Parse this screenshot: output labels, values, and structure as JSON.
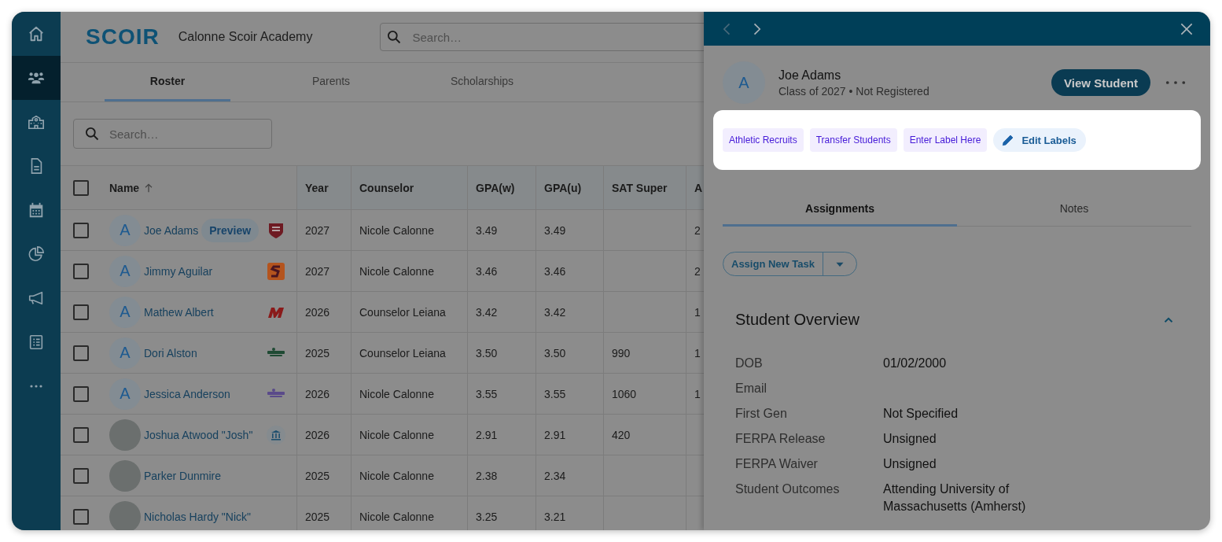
{
  "sidebar": {
    "items": [
      {
        "kind": "home",
        "selected": false
      },
      {
        "kind": "people",
        "selected": true
      },
      {
        "kind": "school",
        "selected": false
      },
      {
        "kind": "document",
        "selected": false
      },
      {
        "kind": "calendar",
        "selected": false
      },
      {
        "kind": "chart",
        "selected": false
      },
      {
        "kind": "megaphone",
        "selected": false
      },
      {
        "kind": "checklist",
        "selected": false
      },
      {
        "kind": "more",
        "selected": false
      }
    ]
  },
  "header": {
    "logo": "SCOIR",
    "school": "Calonne Scoir Academy",
    "search": {
      "placeholder": "Search…"
    }
  },
  "tabs": [
    {
      "label": "Roster",
      "selected": true
    },
    {
      "label": "Parents",
      "selected": false
    },
    {
      "label": "Scholarships",
      "selected": false
    }
  ],
  "roster_search": {
    "placeholder": "Search…"
  },
  "table": {
    "select_all_checked": false,
    "columns": [
      {
        "label": "Name",
        "sorted": true
      },
      {
        "label": "Year"
      },
      {
        "label": "Counselor"
      },
      {
        "label": "GPA(w)"
      },
      {
        "label": "GPA(u)"
      },
      {
        "label": "SAT Super"
      },
      {
        "label": "A"
      }
    ],
    "rows": [
      {
        "checked": false,
        "avatar": {
          "kind": "initial",
          "text": "A"
        },
        "preview": "Preview",
        "logo": {
          "kind": "shield",
          "color": "#6e1a22"
        },
        "cells": [
          "Joe Adams",
          "2027",
          "Nicole Calonne",
          "3.49",
          "3.49",
          "",
          "2"
        ]
      },
      {
        "checked": false,
        "avatar": {
          "kind": "initial",
          "text": "A"
        },
        "logo": {
          "kind": "tile",
          "color": "#b4541e"
        },
        "cells": [
          "Jimmy Aguilar",
          "2027",
          "Nicole Calonne",
          "3.46",
          "3.46",
          "",
          "2"
        ]
      },
      {
        "checked": false,
        "avatar": {
          "kind": "initial",
          "text": "A"
        },
        "logo": {
          "kind": "mark",
          "color": "#8a1a1a"
        },
        "cells": [
          "Mathew Albert",
          "2026",
          "Counselor Leiana",
          "3.42",
          "3.42",
          "",
          "1"
        ]
      },
      {
        "checked": false,
        "avatar": {
          "kind": "initial",
          "text": "A"
        },
        "logo": {
          "kind": "wordmark",
          "color": "#1f4a33"
        },
        "cells": [
          "Dori Alston",
          "2025",
          "Counselor Leiana",
          "3.50",
          "3.50",
          "990",
          "1"
        ]
      },
      {
        "checked": false,
        "avatar": {
          "kind": "initial",
          "text": "A"
        },
        "logo": {
          "kind": "wordmark",
          "color": "#5a4a8a"
        },
        "cells": [
          "Jessica Anderson",
          "2026",
          "Nicole Calonne",
          "3.55",
          "3.55",
          "1060",
          "1"
        ]
      },
      {
        "checked": false,
        "avatar": {
          "kind": "photo"
        },
        "logo": {
          "kind": "bank",
          "color": "#1f4f6e"
        },
        "cells": [
          "Joshua Atwood \"Josh\"",
          "2026",
          "Nicole Calonne",
          "2.91",
          "2.91",
          "420",
          ""
        ]
      },
      {
        "checked": false,
        "avatar": {
          "kind": "photo"
        },
        "cells": [
          "Parker Dunmire",
          "2025",
          "Nicole Calonne",
          "2.38",
          "2.34",
          "",
          ""
        ]
      },
      {
        "checked": false,
        "avatar": {
          "kind": "photo"
        },
        "cells": [
          "Nicholas Hardy \"Nick\"",
          "2025",
          "Nicole Calonne",
          "3.25",
          "3.21",
          "",
          ""
        ]
      }
    ]
  },
  "panel": {
    "nav": {
      "previous_disabled": true,
      "next_disabled": false
    },
    "student": {
      "initial": "A",
      "name": "Joe Adams",
      "subtitle": "Class of 2027 • Not Registered"
    },
    "view_button": "View Student",
    "labels": [
      "Athletic Recruits",
      "Transfer Students",
      "Enter Label Here"
    ],
    "edit_labels": "Edit Labels",
    "tabs": [
      {
        "label": "Assignments",
        "selected": true
      },
      {
        "label": "Notes",
        "selected": false
      }
    ],
    "assign_button": "Assign New Task",
    "overview": {
      "title": "Student Overview",
      "expanded": true,
      "fields": [
        {
          "label": "DOB",
          "value": "01/02/2000"
        },
        {
          "label": "Email"
        },
        {
          "label": "First Gen",
          "value": "Not Specified"
        },
        {
          "label": "FERPA Release",
          "value": "Unsigned"
        },
        {
          "label": "FERPA Waiver",
          "value": "Unsigned"
        },
        {
          "label": "Student Outcomes",
          "value": "Attending University of Massachusetts (Amherst)"
        }
      ]
    }
  }
}
